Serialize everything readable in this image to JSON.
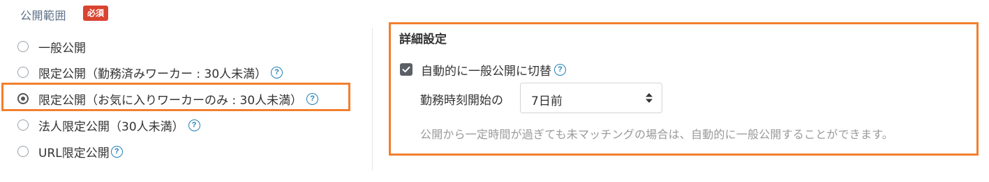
{
  "header": {
    "label": "公開範囲",
    "required_badge": "必須"
  },
  "visibility_options": [
    {
      "label": "一般公開",
      "checked": false,
      "has_help": false
    },
    {
      "label": "限定公開（勤務済みワーカー : 30人未満）",
      "checked": false,
      "has_help": true
    },
    {
      "label": "限定公開（お気に入りワーカーのみ : 30人未満）",
      "checked": true,
      "has_help": true
    },
    {
      "label": "法人限定公開（30人未満）",
      "checked": false,
      "has_help": true
    },
    {
      "label": "URL限定公開",
      "checked": false,
      "has_help": true
    }
  ],
  "detail_settings": {
    "title": "詳細設定",
    "auto_switch_label": "自動的に一般公開に切替",
    "auto_switch_checked": true,
    "start_label": "勤務時刻開始の",
    "select_value": "7日前",
    "help_text": "公開から一定時間が過ぎても未マッチングの場合は、自動的に一般公開することができます。"
  },
  "icons": {
    "help": "question-circle-icon",
    "check": "check-icon",
    "select_caret": "sort-caret-icon"
  },
  "colors": {
    "highlight": "#f27f2e",
    "required_badge": "#d9432f",
    "help_icon": "#1f7fb7"
  }
}
